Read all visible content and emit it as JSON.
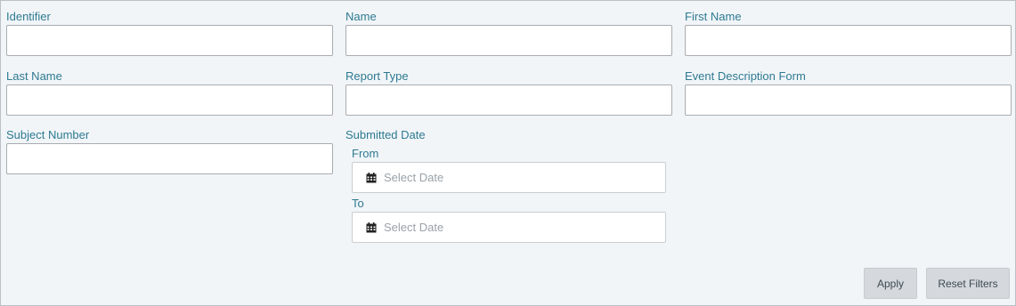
{
  "fields": {
    "identifier": {
      "label": "Identifier",
      "value": ""
    },
    "name": {
      "label": "Name",
      "value": ""
    },
    "first_name": {
      "label": "First Name",
      "value": ""
    },
    "last_name": {
      "label": "Last Name",
      "value": ""
    },
    "report_type": {
      "label": "Report Type",
      "value": ""
    },
    "event_description_form": {
      "label": "Event Description Form",
      "value": ""
    },
    "subject_number": {
      "label": "Subject Number",
      "value": ""
    }
  },
  "submitted_date": {
    "label": "Submitted Date",
    "from": {
      "label": "From",
      "placeholder": "Select Date"
    },
    "to": {
      "label": "To",
      "placeholder": "Select Date"
    }
  },
  "actions": {
    "apply_label": "Apply",
    "reset_label": "Reset Filters"
  },
  "icons": {
    "date_picker": "calendar-icon"
  }
}
